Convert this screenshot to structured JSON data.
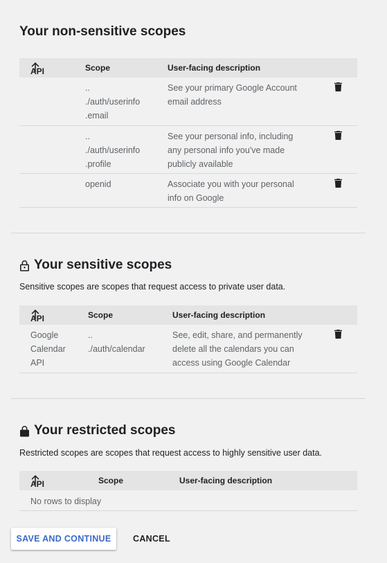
{
  "nonsensitive": {
    "title": "Your non-sensitive scopes",
    "headers": {
      "api": "API",
      "scope": "Scope",
      "description": "User-facing description"
    },
    "rows": [
      {
        "api": "",
        "scope": [
          "..",
          "./auth/userinfo",
          ".email"
        ],
        "description": [
          "See your primary Google Account",
          "email address"
        ]
      },
      {
        "api": "",
        "scope": [
          "..",
          "./auth/userinfo",
          ".profile"
        ],
        "description": [
          "See your personal info, including",
          "any personal info you've made",
          "publicly available"
        ]
      },
      {
        "api": "",
        "scope": [
          "openid"
        ],
        "description": [
          "Associate you with your personal",
          "info on Google"
        ]
      }
    ]
  },
  "sensitive": {
    "title": "Your sensitive scopes",
    "description": "Sensitive scopes are scopes that request access to private user data.",
    "headers": {
      "api": "API",
      "scope": "Scope",
      "description": "User-facing description"
    },
    "rows": [
      {
        "api": [
          "Google",
          "Calendar",
          "API"
        ],
        "scope": [
          "..",
          "./auth/calendar"
        ],
        "description": [
          "See, edit, share, and permanently",
          "delete all the calendars you can",
          "access using Google Calendar"
        ]
      }
    ]
  },
  "restricted": {
    "title": "Your restricted scopes",
    "description": "Restricted scopes are scopes that request access to highly sensitive user data.",
    "headers": {
      "api": "API",
      "scope": "Scope",
      "description": "User-facing description"
    },
    "empty_text": "No rows to display"
  },
  "actions": {
    "save_label": "SAVE AND CONTINUE",
    "cancel_label": "CANCEL"
  },
  "colors": {
    "background": "#f1f1f1",
    "header_bg": "#e4e4e4",
    "primary": "#3b6ac8"
  },
  "icons": {
    "sort": "arrow-up-icon",
    "delete": "trash-icon",
    "lock": "lock-icon"
  }
}
